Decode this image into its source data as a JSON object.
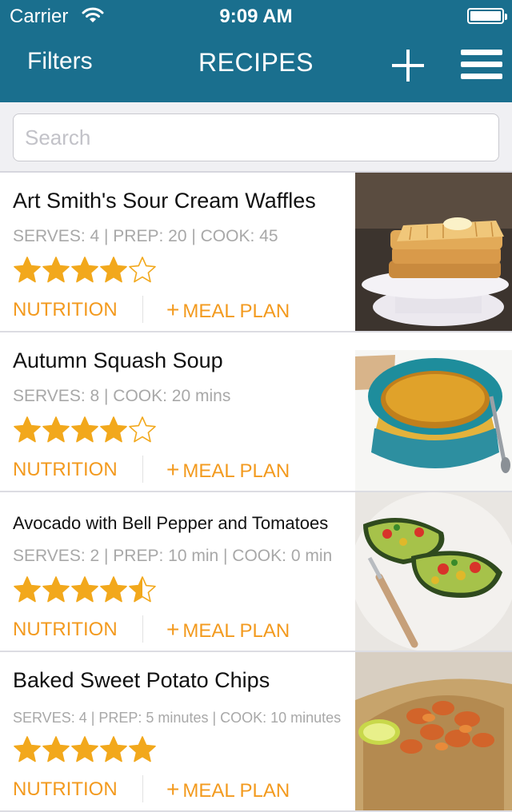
{
  "status": {
    "carrier": "Carrier",
    "time": "9:09 AM"
  },
  "nav": {
    "filters": "Filters",
    "title": "RECIPES"
  },
  "search": {
    "placeholder": "Search"
  },
  "colors": {
    "header": "#1a6f8e",
    "accent": "#f39a1e",
    "star": "#f2a81c"
  },
  "recipes": [
    {
      "name": "Art Smith's Sour Cream Waffles",
      "meta": "SERVES: 4 | PREP: 20 | COOK: 45",
      "rating": 4,
      "nutrition": "NUTRITION",
      "meal_plan": "MEAL PLAN",
      "image": "waffles"
    },
    {
      "name": "Autumn Squash Soup",
      "meta": "SERVES: 8 | COOK: 20 mins",
      "rating": 4,
      "nutrition": "NUTRITION",
      "meal_plan": "MEAL PLAN",
      "image": "soup"
    },
    {
      "name": "Avocado with Bell Pepper and Tomatoes",
      "meta": "SERVES: 2 | PREP: 10 min | COOK: 0 min",
      "rating": 4.5,
      "nutrition": "NUTRITION",
      "meal_plan": "MEAL PLAN",
      "image": "avocado"
    },
    {
      "name": "Baked Sweet Potato Chips",
      "meta": "SERVES: 4 | PREP: 5 minutes | COOK: 10 minutes",
      "rating": 5,
      "nutrition": "NUTRITION",
      "meal_plan": "MEAL PLAN",
      "image": "chips"
    }
  ]
}
